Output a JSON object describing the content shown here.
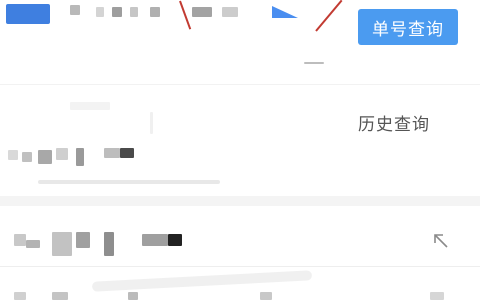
{
  "header": {
    "query_button_label": "单号查询",
    "accent_color": "#4b9bf0",
    "logo_color": "#3f7fe0",
    "annotation_color": "#c23b32"
  },
  "history": {
    "link_label": "历史查询"
  },
  "records": [
    {
      "id_text_redacted": true,
      "action_icon": ""
    },
    {
      "id_text_redacted": true,
      "action_icon": "arrow-up-left-icon"
    }
  ]
}
